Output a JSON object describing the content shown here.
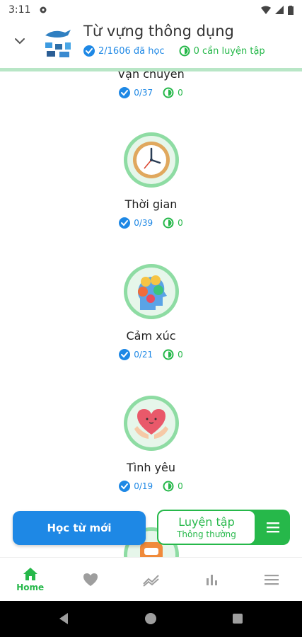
{
  "status_bar": {
    "time": "3:11"
  },
  "header": {
    "title": "Từ vựng thông dụng",
    "learned": "2/1606 đã học",
    "practice": "0 cần luyện tập"
  },
  "topics": [
    {
      "name": "Vận chuyển",
      "learned": "0/37",
      "practice": "0",
      "icon": "vehicle-icon"
    },
    {
      "name": "Thời gian",
      "learned": "0/39",
      "practice": "0",
      "icon": "clock-icon"
    },
    {
      "name": "Cảm xúc",
      "learned": "0/21",
      "practice": "0",
      "icon": "emotions-icon"
    },
    {
      "name": "Tình yêu",
      "learned": "0/19",
      "practice": "0",
      "icon": "heart-hands-icon"
    }
  ],
  "actions": {
    "learn_new": "Học từ mới",
    "practice": "Luyện tập",
    "practice_mode": "Thông thường"
  },
  "bottom_nav": {
    "home": "Home"
  },
  "colors": {
    "accent_green": "#26b84a",
    "accent_blue": "#1e88e5",
    "ring": "#8edca3"
  }
}
